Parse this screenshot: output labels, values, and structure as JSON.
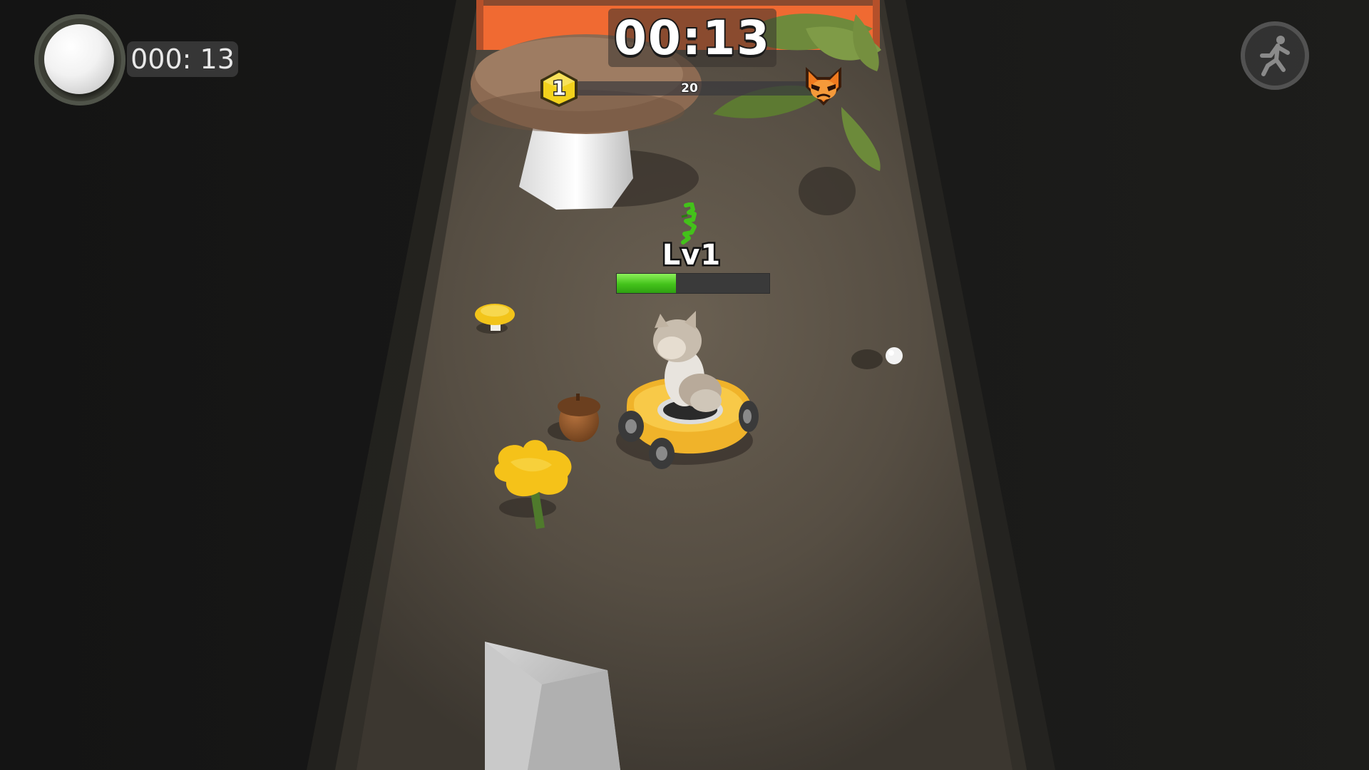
{
  "hud": {
    "ball_timer": "000: 13",
    "round_timer": "00:13",
    "progress_value": "20",
    "player_level_badge": "1",
    "sprint_icon": "running-person-icon",
    "enemy_icon": "angry-cat-icon",
    "collected_item_icon": "white-ball-icon"
  },
  "player": {
    "level_label": "Lv1",
    "xp_fraction": 0.39,
    "speech_icon": "green-scribble-icon"
  },
  "colors": {
    "xp_fill": "#43c21a",
    "level_badge": "#f2d21c",
    "enemy_badge": "#f07a1e",
    "floor": "#5a5246",
    "back_wall": "#f06a32"
  }
}
